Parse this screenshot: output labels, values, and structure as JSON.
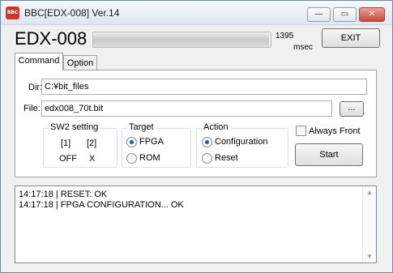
{
  "window": {
    "icon_text": "BBC",
    "title": "BBC[EDX-008] Ver.14",
    "minimize_glyph": "—",
    "maximize_glyph": "▭",
    "close_glyph": "✕"
  },
  "header": {
    "device": "EDX-008",
    "progress_fraction": 0.99,
    "ms_value": "1395",
    "ms_unit": "msec",
    "exit_label": "EXIT"
  },
  "tabs": [
    {
      "label": "Command",
      "active": true
    },
    {
      "label": "Option",
      "active": false
    }
  ],
  "dir": {
    "label": "Dir:",
    "value": "C:¥bit_files"
  },
  "file": {
    "label": "File:",
    "value": "edx008_70t.bit",
    "browse_label": "..."
  },
  "sw2": {
    "title": "SW2 setting",
    "headers": [
      "[1]",
      "[2]"
    ],
    "values": [
      "OFF",
      "X"
    ]
  },
  "target": {
    "title": "Target",
    "options": [
      {
        "label": "FPGA",
        "selected": true
      },
      {
        "label": "ROM",
        "selected": false
      }
    ]
  },
  "action": {
    "title": "Action",
    "options": [
      {
        "label": "Configuration",
        "selected": true
      },
      {
        "label": "Reset",
        "selected": false
      }
    ]
  },
  "always_front": {
    "label": "Always Front",
    "checked": false
  },
  "start_label": "Start",
  "log": {
    "lines": [
      "14:17:18 | RESET: OK",
      "14:17:18 | FPGA CONFIGURATION... OK"
    ],
    "scroll_up_glyph": "▲",
    "scroll_down_glyph": "▼"
  }
}
